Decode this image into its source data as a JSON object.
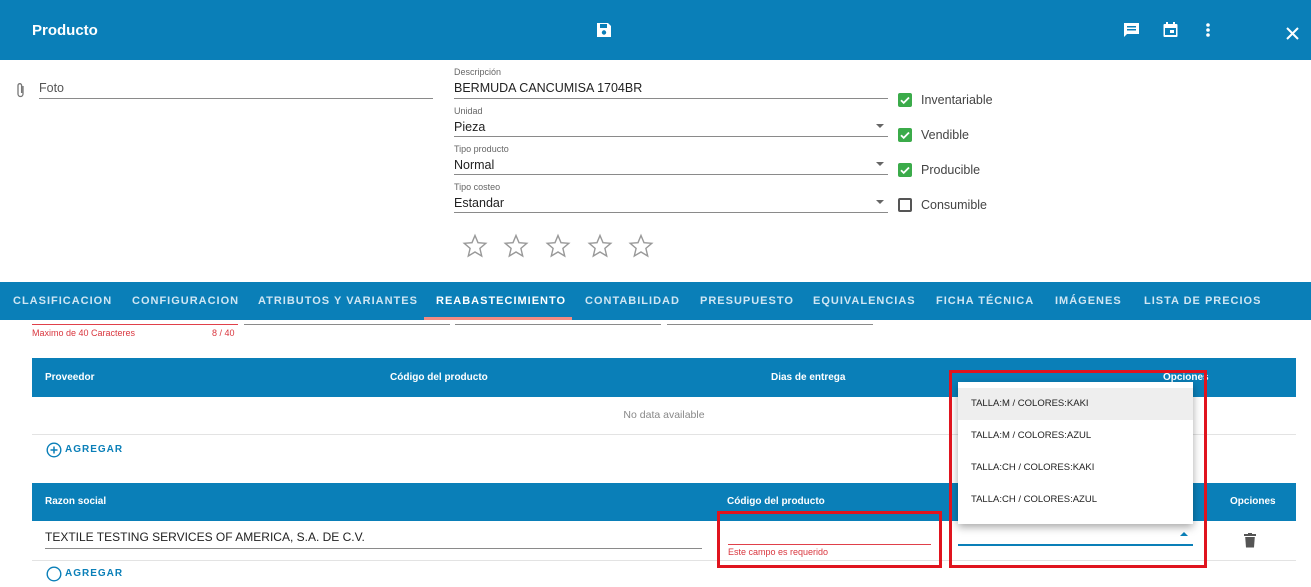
{
  "header": {
    "title": "Producto"
  },
  "form": {
    "foto_label": "Foto",
    "descripcion": {
      "label": "Descripción",
      "value": "BERMUDA CANCUMISA 1704BR"
    },
    "unidad": {
      "label": "Unidad",
      "value": "Pieza"
    },
    "tipo_producto": {
      "label": "Tipo producto",
      "value": "Normal"
    },
    "tipo_costeo": {
      "label": "Tipo costeo",
      "value": "Estandar"
    },
    "checkboxes": [
      {
        "label": "Inventariable",
        "checked": true
      },
      {
        "label": "Vendible",
        "checked": true
      },
      {
        "label": "Producible",
        "checked": true
      },
      {
        "label": "Consumible",
        "checked": false
      }
    ],
    "rating": {
      "value": 0,
      "max": 5
    }
  },
  "tabs": [
    {
      "label": "CLASIFICACION"
    },
    {
      "label": "CONFIGURACION"
    },
    {
      "label": "ATRIBUTOS Y VARIANTES"
    },
    {
      "label": "REABASTECIMIENTO",
      "active": true
    },
    {
      "label": "CONTABILIDAD"
    },
    {
      "label": "PRESUPUESTO"
    },
    {
      "label": "EQUIVALENCIAS"
    },
    {
      "label": "FICHA TÉCNICA"
    },
    {
      "label": "IMÁGENES"
    },
    {
      "label": "LISTA DE PRECIOS"
    }
  ],
  "char_counter": {
    "hint": "Maximo de 40 Caracteres",
    "count": "8 / 40"
  },
  "table1": {
    "headers": [
      "Proveedor",
      "Código del producto",
      "Dias de entrega",
      "Opciones"
    ],
    "empty_text": "No data available",
    "add_label": "AGREGAR"
  },
  "table2": {
    "headers": [
      "Razon social",
      "Código del producto",
      "Opciones"
    ],
    "row": {
      "razon_social": "TEXTILE TESTING SERVICES OF AMERICA, S.A. DE C.V.",
      "codigo_error": "Este campo es requerido"
    },
    "add_label": "AGREGAR"
  },
  "dropdown": {
    "options": [
      "TALLA:M / COLORES:KAKI",
      "TALLA:M / COLORES:AZUL",
      "TALLA:CH / COLORES:KAKI",
      "TALLA:CH / COLORES:AZUL"
    ],
    "highlighted_index": 0
  },
  "colors": {
    "primary": "#0a7fb8",
    "check": "#3bab4a",
    "error": "#e0141e",
    "error_text": "#d9363e"
  }
}
